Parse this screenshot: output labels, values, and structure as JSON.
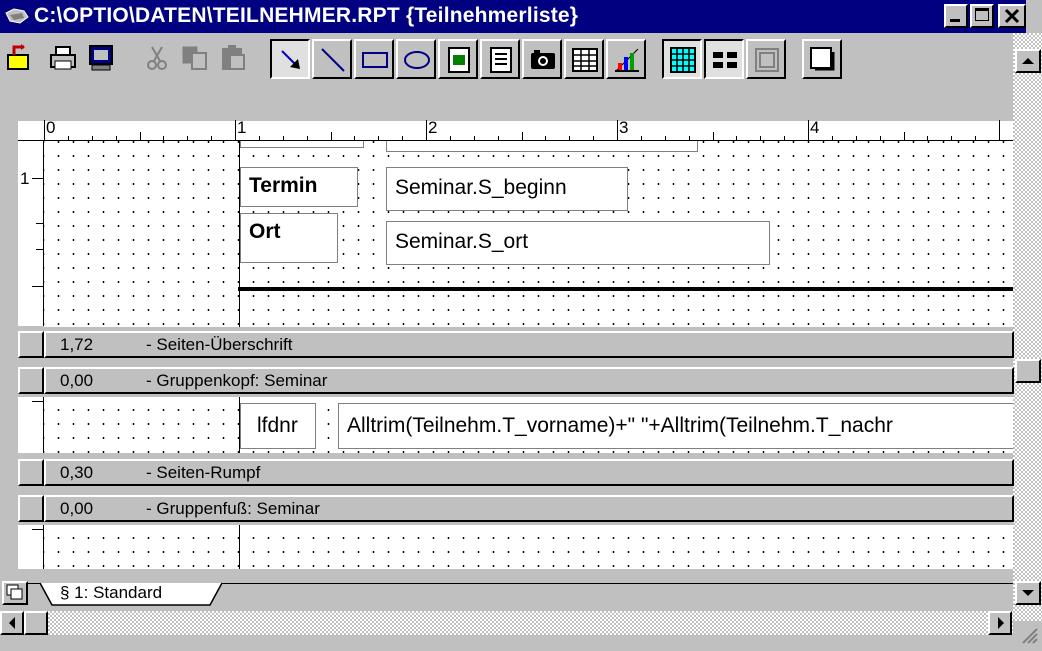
{
  "window": {
    "title": "C:\\OPTIO\\DATEN\\TEILNEHMER.RPT {Teilnehmerliste}"
  },
  "toolbar": {
    "buttons": [
      "exit-icon",
      "print-icon",
      "preview-icon",
      "cut-icon",
      "copy-icon",
      "paste-icon",
      "select-arrow-icon",
      "line-icon",
      "rectangle-icon",
      "ellipse-icon",
      "text-field-icon",
      "memo-field-icon",
      "picture-icon",
      "table-icon",
      "chart-icon",
      "grid-icon",
      "band-layout-icon",
      "page-icon",
      "shadow-icon"
    ]
  },
  "ruler": {
    "labels": [
      "0",
      "1",
      "2",
      "3",
      "4"
    ]
  },
  "vruler": {
    "label": "1"
  },
  "labels": {
    "termin": "Termin",
    "ort": "Ort",
    "lfdnr": "lfdnr"
  },
  "fields": {
    "seminar_beginn": "Seminar.S_beginn",
    "seminar_ort": "Seminar.S_ort",
    "teilnehmer_name": "Alltrim(Teilnehm.T_vorname)+\" \"+Alltrim(Teilnehm.T_nachr"
  },
  "bands": [
    {
      "value": "1,72",
      "name": "- Seiten-Überschrift"
    },
    {
      "value": "0,00",
      "name": "- Gruppenkopf: Seminar"
    },
    {
      "value": "0,30",
      "name": "- Seiten-Rumpf"
    },
    {
      "value": "0,00",
      "name": "- Gruppenfuß: Seminar"
    }
  ],
  "tabs": {
    "active": "§ 1: Standard"
  },
  "colors": {
    "titlebar": "#000080",
    "face": "#c0c0c0",
    "canvas": "#ffffff",
    "grid_cyan": "#00ffff"
  }
}
